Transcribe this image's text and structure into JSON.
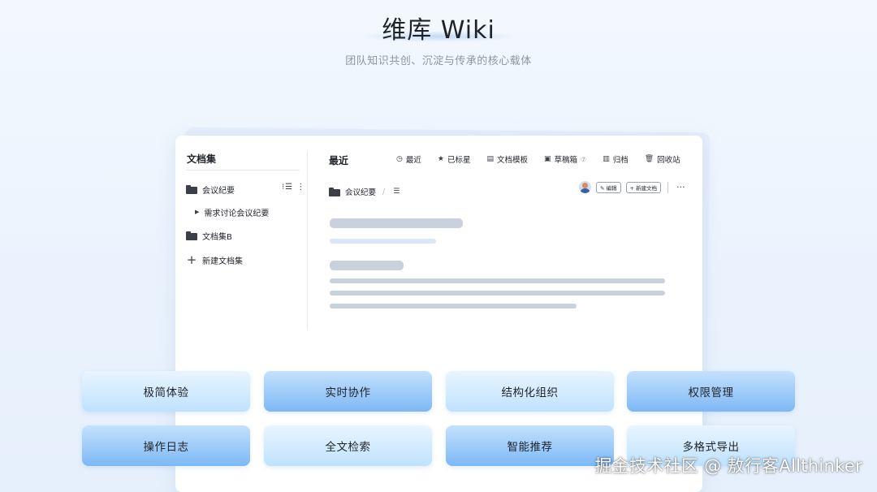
{
  "hero": {
    "title": "维库 Wiki",
    "subtitle": "团队知识共创、沉淀与传承的核心载体"
  },
  "sidebar": {
    "title": "文档集",
    "items": [
      {
        "label": "会议纪要",
        "icon": "folder-icon"
      },
      {
        "label": "需求讨论会议纪要",
        "icon": "caret-right-icon"
      },
      {
        "label": "文档集B",
        "icon": "folder-icon"
      },
      {
        "label": "新建文档集",
        "icon": "plus-icon"
      }
    ],
    "item_actions": "⁝☰ ⋮"
  },
  "main": {
    "title": "最近",
    "nav": [
      {
        "label": "最近",
        "icon": "clock-icon"
      },
      {
        "label": "已标星",
        "icon": "star-icon"
      },
      {
        "label": "文档模板",
        "icon": "template-icon"
      },
      {
        "label": "草稿箱",
        "icon": "draft-icon",
        "badge": "⑦"
      },
      {
        "label": "归档",
        "icon": "archive-icon"
      },
      {
        "label": "回收站",
        "icon": "trash-icon"
      }
    ],
    "breadcrumb": {
      "label": "会议纪要",
      "sep": "/"
    },
    "actions": {
      "edit": "✎ 编辑",
      "new_doc": "+ 新建文档",
      "more": "···"
    }
  },
  "features": [
    {
      "label": "极简体验"
    },
    {
      "label": "实时协作"
    },
    {
      "label": "结构化组织"
    },
    {
      "label": "权限管理"
    },
    {
      "label": "操作日志"
    },
    {
      "label": "全文检索"
    },
    {
      "label": "智能推荐"
    },
    {
      "label": "多格式导出"
    }
  ],
  "watermark": "掘金技术社区 @ 敖行客Allthinker"
}
